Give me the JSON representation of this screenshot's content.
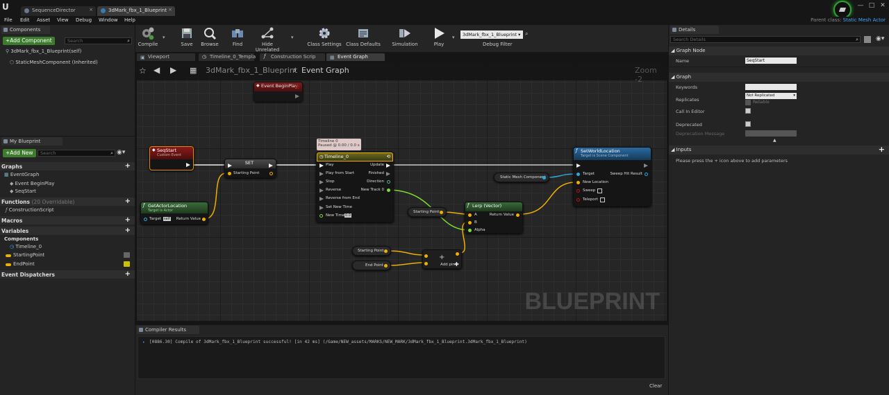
{
  "titlebar": {
    "tabs": [
      "SequenceDirector",
      "3dMark_fbx_1_Blueprint"
    ],
    "window_buttons": [
      "—",
      "□",
      "✕"
    ]
  },
  "menubar": {
    "items": [
      "File",
      "Edit",
      "Asset",
      "View",
      "Debug",
      "Window",
      "Help"
    ],
    "parent_class_label": "Parent class:",
    "parent_class_value": "Static Mesh Actor"
  },
  "components_panel": {
    "title": "Components",
    "add_button": "+Add Component",
    "search_placeholder": "Search",
    "items": [
      "3dMark_fbx_1_Blueprint(self)",
      "StaticMeshComponent (Inherited)"
    ]
  },
  "my_blueprint": {
    "title": "My Blueprint",
    "add_button": "+Add New",
    "search_placeholder": "Search",
    "graphs_label": "Graphs",
    "graphs": [
      "EventGraph",
      "Event BeginPlay",
      "SeqStart"
    ],
    "functions_label": "Functions",
    "functions_sub": "(20 Overridable)",
    "functions": [
      "ConstructionScript"
    ],
    "macros_label": "Macros",
    "variables_label": "Variables",
    "components_label": "Components",
    "variables": [
      "Timeline_0",
      "StartingPoint",
      "EndPoint"
    ],
    "dispatchers_label": "Event Dispatchers"
  },
  "toolbar": {
    "buttons": [
      "Compile",
      "Save",
      "Browse",
      "Find",
      "Hide Unrelated",
      "Class Settings",
      "Class Defaults",
      "Simulation",
      "Play"
    ],
    "debug_object": "3dMark_fbx_1_Blueprint",
    "debug_filter_label": "Debug Filter"
  },
  "graph_tabs": [
    "Viewport",
    "Timeline_0_Templa",
    "Construction Scrip",
    "Event Graph"
  ],
  "graph": {
    "breadcrumb_root": "3dMark_fbx_1_Blueprint",
    "breadcrumb_sep": "›",
    "breadcrumb_current": "Event Graph",
    "zoom": "Zoom -2",
    "watermark": "BLUEPRINT",
    "nodes": {
      "begin_play": {
        "title": "Event BeginPlay"
      },
      "seq_start": {
        "title": "SeqStart",
        "subtitle": "Custom Event"
      },
      "get_actor_location": {
        "title": "GetActorLocation",
        "subtitle": "Target is Actor",
        "pins": [
          "Target",
          "self",
          "Return Value"
        ]
      },
      "set": {
        "title": "SET",
        "pins": [
          "Starting Point"
        ]
      },
      "timeline_comment": [
        "Timeline 0",
        "Paused @ 0.00 / 0.0 s"
      ],
      "timeline": {
        "title": "Timeline_0",
        "inputs": [
          "Play",
          "Play from Start",
          "Stop",
          "Reverse",
          "Reverse from End",
          "Set New Time",
          "New Time"
        ],
        "new_time_value": "0.0",
        "outputs": [
          "Update",
          "Finished",
          "Direction",
          "New Track 0"
        ]
      },
      "static_mesh": {
        "title": "Static Mesh Component"
      },
      "set_world_location": {
        "title": "SetWorldLocation",
        "subtitle": "Target is Scene Component",
        "pins": [
          "Target",
          "New Location",
          "Sweep",
          "Teleport"
        ],
        "outputs": [
          "Sweep Hit Result"
        ]
      },
      "starting_point_a": {
        "title": "Starting Point"
      },
      "lerp": {
        "title": "Lerp (Vector)",
        "pins": [
          "A",
          "B",
          "Alpha"
        ],
        "outputs": [
          "Return Value"
        ]
      },
      "starting_point_b": {
        "title": "Starting Point"
      },
      "end_point": {
        "title": "End Point"
      },
      "add": {
        "title": "+",
        "pins": [
          "Add pin"
        ]
      }
    }
  },
  "compiler": {
    "title": "Compiler Results",
    "message": "[0886.30] Compile of 3dMark_fbx_1_Blueprint successful! [in 42 ms] (/Game/NEW_assets/MARKS/NEW_MARK/3dMark_fbx_1_Blueprint.3dMark_fbx_1_Blueprint)",
    "clear": "Clear"
  },
  "details": {
    "title": "Details",
    "search_placeholder": "Search Details",
    "graph_node_section": "Graph Node",
    "name_label": "Name",
    "name_value": "SeqStart",
    "graph_section": "Graph",
    "keywords_label": "Keywords",
    "replicates_label": "Replicates",
    "replicates_value": "Not Replicated",
    "reliable_label": "Reliable",
    "call_in_editor_label": "Call In Editor",
    "deprecated_label": "Deprecated",
    "deprecation_message_label": "Deprecation Message",
    "inputs_section": "Inputs",
    "inputs_hint": "Please press the + icon above to add parameters"
  },
  "colors": {
    "exec": "#eeeeee",
    "vector": "#f0b000",
    "float": "#7ddd30",
    "object": "#2fa8e0",
    "bool": "#c21010",
    "add_button": "#3c7c2c"
  }
}
